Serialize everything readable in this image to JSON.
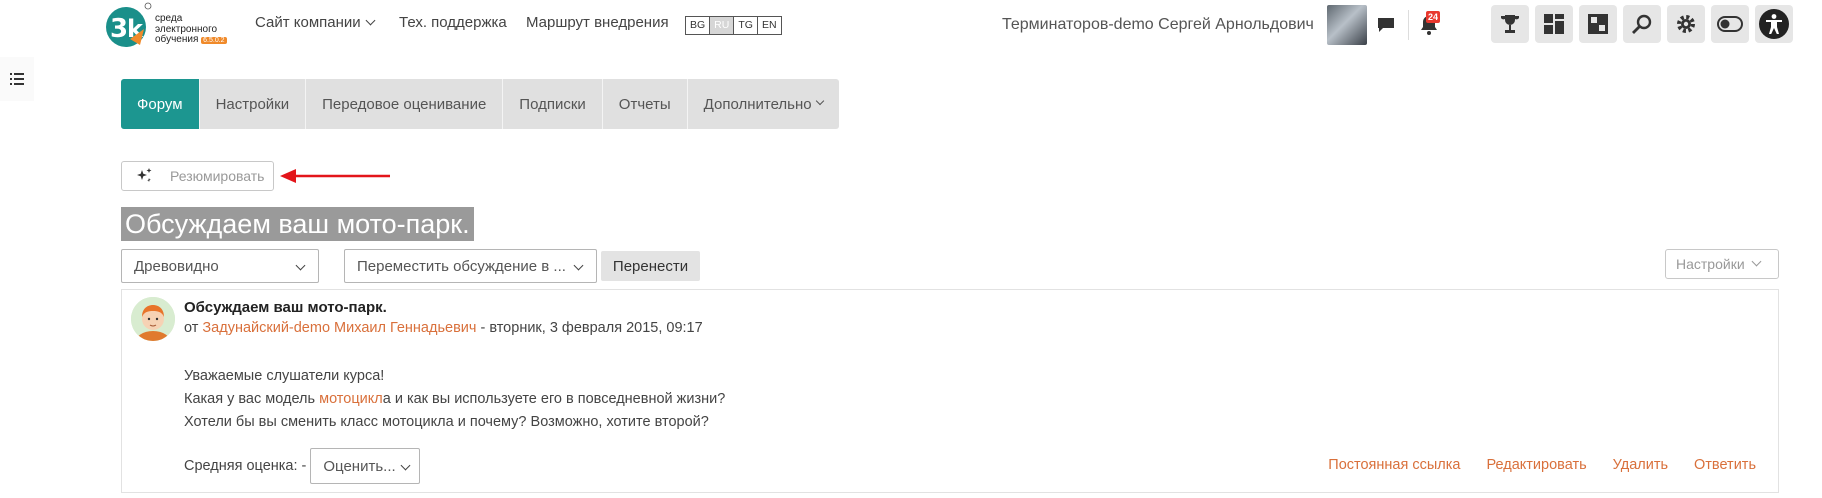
{
  "header": {
    "logo": {
      "line1": "среда",
      "line2": "электронного",
      "line3": "обучения",
      "badge": "6.5.0.2"
    },
    "nav": [
      {
        "label": "Сайт компании"
      },
      {
        "label": "Тех. поддержка"
      },
      {
        "label": "Маршрут внедрения"
      }
    ],
    "languages": [
      "BG",
      "RU",
      "TG",
      "EN"
    ],
    "active_language": "RU",
    "username": "Терминаторов-demo Сергей Арнольдович",
    "notification_count": "24",
    "tool_icons": [
      "trophy-icon",
      "dashboard-icon",
      "grid-icon",
      "search-icon",
      "gear-icon",
      "toggle-icon",
      "accessibility-icon"
    ]
  },
  "tabs": [
    {
      "label": "Форум",
      "active": true
    },
    {
      "label": "Настройки"
    },
    {
      "label": "Передовое оценивание"
    },
    {
      "label": "Подписки"
    },
    {
      "label": "Отчеты"
    },
    {
      "label": "Дополнительно"
    }
  ],
  "summarize_label": "Резюмировать",
  "page_title": "Обсуждаем ваш мото-парк.",
  "controls": {
    "display_mode": "Древовидно",
    "move_select": "Переместить обсуждение в ...",
    "move_button": "Перенести",
    "settings": "Настройки"
  },
  "post": {
    "subject": "Обсуждаем ваш мото-парк.",
    "by": "от",
    "author": "Задунайский-demo Михаил Геннадьевич",
    "date": " - вторник, 3 февраля 2015, 09:17",
    "body": {
      "line1": "Уважаемые слушатели курса!",
      "line2_prefix": "Какая у вас модель ",
      "line2_link": "мотоцикл",
      "line2_suffix": "а и как вы используете его в повседневной жизни?",
      "line3": "Хотели бы вы сменить класс мотоцикла и почему? Возможно, хотите второй?"
    },
    "rating_label": "Средняя оценка: -",
    "rating_select": "Оценить...",
    "actions": [
      "Постоянная ссылка",
      "Редактировать",
      "Удалить",
      "Ответить"
    ]
  },
  "colors": {
    "accent": "#1c9690",
    "link": "#d9703b",
    "annotation_arrow": "#e3151a"
  }
}
